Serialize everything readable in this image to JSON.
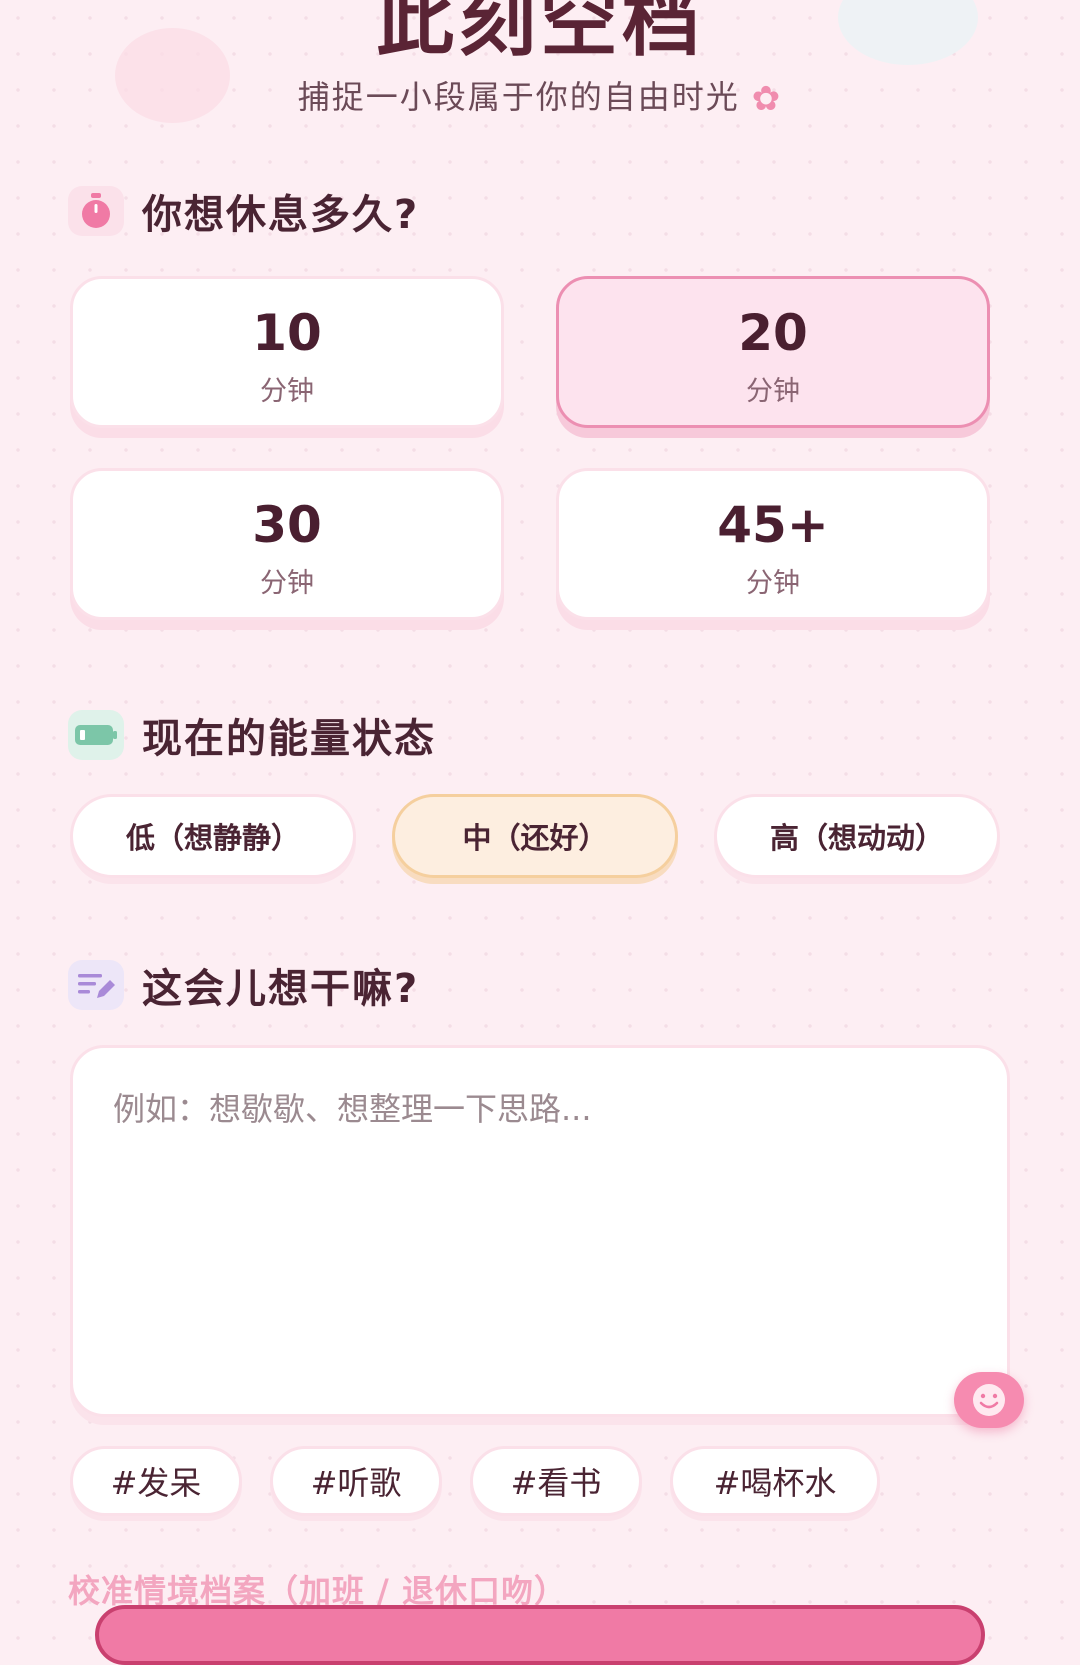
{
  "header": {
    "title": "此刻空档",
    "subtitle": "捕捉一小段属于你的自由时光"
  },
  "duration": {
    "heading": "你想休息多久?",
    "icon": "stopwatch-icon",
    "options": [
      {
        "value": "10",
        "unit": "分钟",
        "selected": false
      },
      {
        "value": "20",
        "unit": "分钟",
        "selected": true
      },
      {
        "value": "30",
        "unit": "分钟",
        "selected": false
      },
      {
        "value": "45+",
        "unit": "分钟",
        "selected": false
      }
    ]
  },
  "energy": {
    "heading": "现在的能量状态",
    "icon": "battery-icon",
    "options": [
      {
        "label": "低（想静静）",
        "selected": false
      },
      {
        "label": "中（还好）",
        "selected": true
      },
      {
        "label": "高（想动动）",
        "selected": false
      }
    ]
  },
  "activity": {
    "heading": "这会儿想干嘛?",
    "icon": "note-pencil-icon",
    "placeholder": "例如：想歇歇、想整理一下思路...",
    "value": "",
    "emoji_icon": "smiley-icon"
  },
  "tags": [
    "#发呆",
    "#听歌",
    "#看书",
    "#喝杯水"
  ],
  "calibration": {
    "label": "校准情境档案（加班 / 退休口吻）"
  },
  "colors": {
    "background": "#fdeef3",
    "accent_pink": "#ec8fb2",
    "selected_card": "#fde3ee",
    "selected_energy": "#fdeee0",
    "title_text": "#5a2435"
  }
}
